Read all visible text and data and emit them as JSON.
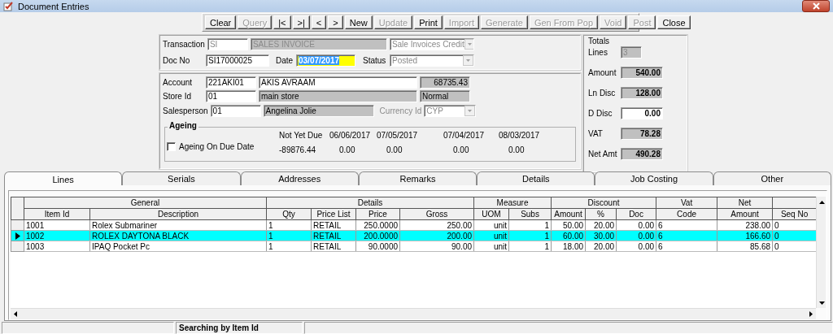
{
  "window": {
    "title": "Document Entries"
  },
  "toolbar": [
    {
      "label": "Clear",
      "disabled": false
    },
    {
      "label": "Query",
      "disabled": true
    },
    {
      "label": "|<",
      "disabled": false
    },
    {
      "label": ">|",
      "disabled": false
    },
    {
      "label": "<",
      "disabled": false
    },
    {
      "label": ">",
      "disabled": false
    },
    {
      "label": "New",
      "disabled": false
    },
    {
      "label": "Update",
      "disabled": true
    },
    {
      "label": "Print",
      "disabled": false
    },
    {
      "label": "Import",
      "disabled": true
    },
    {
      "label": "Generate",
      "disabled": true
    },
    {
      "label": "Gen From Pop",
      "disabled": true
    },
    {
      "label": "Void",
      "disabled": true
    },
    {
      "label": "Post",
      "disabled": true
    },
    {
      "label": "Close",
      "disabled": false
    }
  ],
  "transaction": {
    "label": "Transaction",
    "code": "SI",
    "name": "SALES INVOICE",
    "type": "Sale Invoices Credit"
  },
  "doc_no": {
    "label": "Doc No",
    "value": "SI17000025"
  },
  "date": {
    "label": "Date",
    "value": "03/07/2017",
    "focused": true
  },
  "status": {
    "label": "Status",
    "value": "Posted"
  },
  "account": {
    "label": "Account",
    "code": "221AKI01",
    "name": "AKIS AVRAAM",
    "balance": "68735.43"
  },
  "store": {
    "label": "Store Id",
    "code": "01",
    "name": "main store",
    "type": "Normal"
  },
  "salesperson": {
    "label": "Salesperson",
    "code": "01",
    "name": "Angelina Jolie"
  },
  "currency": {
    "label": "Currency Id",
    "value": "CYP"
  },
  "ageing": {
    "title": "Ageing",
    "checkbox": {
      "label": "Ageing On Due Date",
      "checked": false
    },
    "columns": [
      "Not Yet Due",
      "06/06/2017",
      "07/05/2017",
      "07/04/2017",
      "08/03/2017"
    ],
    "values": [
      "-89876.44",
      "0.00",
      "0.00",
      "0.00",
      "0.00"
    ]
  },
  "totals": {
    "title": "Totals",
    "fields": [
      {
        "label": "Lines",
        "value": "3",
        "kind": "count"
      },
      {
        "label": "Amount",
        "value": "540.00",
        "kind": "readonly"
      },
      {
        "label": "Ln Disc",
        "value": "128.00",
        "kind": "readonly"
      },
      {
        "label": "D Disc",
        "value": "0.00",
        "kind": "editable"
      },
      {
        "label": "VAT",
        "value": "78.28",
        "kind": "readonly"
      },
      {
        "label": "Net Amt",
        "value": "490.28",
        "kind": "readonly"
      }
    ]
  },
  "tabs": [
    {
      "label": "Lines",
      "selected": true
    },
    {
      "label": "Serials",
      "selected": false
    },
    {
      "label": "Addresses",
      "selected": false
    },
    {
      "label": "Remarks",
      "selected": false
    },
    {
      "label": "Details",
      "selected": false
    },
    {
      "label": "Job Costing",
      "selected": false
    },
    {
      "label": "Other",
      "selected": false
    }
  ],
  "grid": {
    "groups": [
      {
        "label": "General",
        "columns": [
          {
            "label": "Item Id",
            "kind": "text"
          },
          {
            "label": "Description",
            "kind": "text"
          }
        ]
      },
      {
        "label": "Details",
        "columns": [
          {
            "label": "Qty",
            "kind": "text"
          },
          {
            "label": "Price List",
            "kind": "text"
          },
          {
            "label": "Price",
            "kind": "number"
          },
          {
            "label": "Gross",
            "kind": "number"
          }
        ]
      },
      {
        "label": "Measure",
        "columns": [
          {
            "label": "UOM",
            "kind": "number"
          },
          {
            "label": "Subs",
            "kind": "number"
          }
        ]
      },
      {
        "label": "Discount",
        "columns": [
          {
            "label": "Amount",
            "kind": "number"
          },
          {
            "label": "%",
            "kind": "number"
          },
          {
            "label": "Doc",
            "kind": "number"
          }
        ]
      },
      {
        "label": "Vat",
        "columns": [
          {
            "label": "Code",
            "kind": "text"
          }
        ]
      },
      {
        "label": "Net",
        "columns": [
          {
            "label": "Amount",
            "kind": "number"
          }
        ]
      },
      {
        "columns": [
          {
            "label": "Seq No",
            "kind": "text"
          }
        ]
      }
    ],
    "rows": [
      {
        "selected": false,
        "cells": [
          "1001",
          "Rolex Submariner",
          "1",
          "RETAIL",
          "250.0000",
          "250.00",
          "unit",
          "1",
          "50.00",
          "20.00",
          "0.00",
          "6",
          "238.00",
          "0"
        ]
      },
      {
        "selected": true,
        "cells": [
          "1002",
          "ROLEX DAYTONA BLACK",
          "1",
          "RETAIL",
          "200.0000",
          "200.00",
          "unit",
          "1",
          "60.00",
          "30.00",
          "0.00",
          "6",
          "166.60",
          "0"
        ]
      },
      {
        "selected": false,
        "cells": [
          "1003",
          "IPAQ Pocket Pc",
          "1",
          "RETAIL",
          "90.0000",
          "90.00",
          "unit",
          "1",
          "18.00",
          "20.00",
          "0.00",
          "6",
          "85.68",
          "0"
        ]
      }
    ]
  },
  "status_bar": {
    "message": "Searching by Item Id"
  }
}
